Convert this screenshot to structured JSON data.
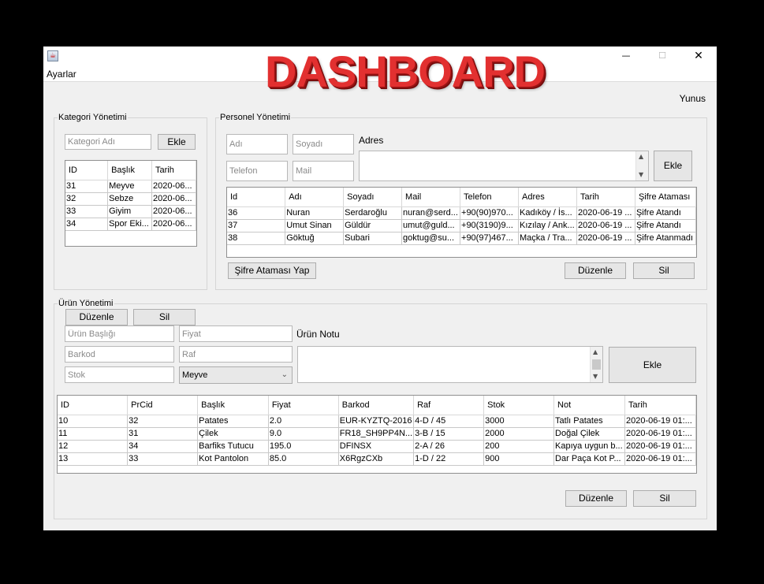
{
  "window": {
    "banner": "DASHBOARD",
    "menu": "Ayarlar",
    "user": "Yunus",
    "controls": {
      "minimize": "—",
      "maximize": "☐",
      "close": "✕"
    }
  },
  "kategori": {
    "title": "Kategori Yönetimi",
    "name_placeholder": "Kategori Adı",
    "add": "Ekle",
    "columns": [
      "ID",
      "Başlık",
      "Tarih"
    ],
    "rows": [
      [
        "31",
        "Meyve",
        "2020-06..."
      ],
      [
        "32",
        "Sebze",
        "2020-06..."
      ],
      [
        "33",
        "Giyim",
        "2020-06..."
      ],
      [
        "34",
        "Spor Eki...",
        "2020-06..."
      ]
    ],
    "edit": "Düzenle",
    "delete": "Sil"
  },
  "personel": {
    "title": "Personel Yönetimi",
    "ad_placeholder": "Adı",
    "soyad_placeholder": "Soyadı",
    "telefon_placeholder": "Telefon",
    "mail_placeholder": "Mail",
    "adres_label": "Adres",
    "add": "Ekle",
    "columns": [
      "Id",
      "Adı",
      "Soyadı",
      "Mail",
      "Telefon",
      "Adres",
      "Tarih",
      "Şifre Ataması"
    ],
    "rows": [
      [
        "36",
        "Nuran",
        "Serdaroğlu",
        "nuran@serd...",
        "+90(90)970...",
        "Kadıköy / İs...",
        "2020-06-19 ...",
        "Şifre Atandı"
      ],
      [
        "37",
        "Umut Sinan",
        "Güldür",
        "umut@guld...",
        "+90(3190)9...",
        "Kızılay / Ank...",
        "2020-06-19 ...",
        "Şifre Atandı"
      ],
      [
        "38",
        "Göktuğ",
        "Subari",
        "goktug@su...",
        "+90(97)467...",
        "Maçka / Tra...",
        "2020-06-19 ...",
        "Şifre Atanmadı"
      ]
    ],
    "assign_password": "Şifre Ataması Yap",
    "edit": "Düzenle",
    "delete": "Sil"
  },
  "urun": {
    "title": "Ürün Yönetimi",
    "baslik_placeholder": "Ürün Başlığı",
    "fiyat_placeholder": "Fiyat",
    "barkod_placeholder": "Barkod",
    "raf_placeholder": "Raf",
    "stok_placeholder": "Stok",
    "category_selected": "Meyve",
    "note_label": "Ürün Notu",
    "add": "Ekle",
    "columns": [
      "ID",
      "PrCid",
      "Başlık",
      "Fiyat",
      "Barkod",
      "Raf",
      "Stok",
      "Not",
      "Tarih"
    ],
    "rows": [
      [
        "10",
        "32",
        "Patates",
        "2.0",
        "EUR-KYZTQ-2016",
        "4-D / 45",
        "3000",
        "Tatlı Patates",
        "2020-06-19 01:..."
      ],
      [
        "11",
        "31",
        "Çilek",
        "9.0",
        "FR18_SH9PP4N...",
        "3-B / 15",
        "2000",
        "Doğal Çilek",
        "2020-06-19 01:..."
      ],
      [
        "12",
        "34",
        "Barfiks Tutucu",
        "195.0",
        "DFINSX",
        "2-A / 26",
        "200",
        "Kapıya uygun b...",
        "2020-06-19 01:..."
      ],
      [
        "13",
        "33",
        "Kot Pantolon",
        "85.0",
        "X6RgzCXb",
        "1-D / 22",
        "900",
        "Dar Paça Kot P...",
        "2020-06-19 01:..."
      ]
    ],
    "edit": "Düzenle",
    "delete": "Sil"
  }
}
